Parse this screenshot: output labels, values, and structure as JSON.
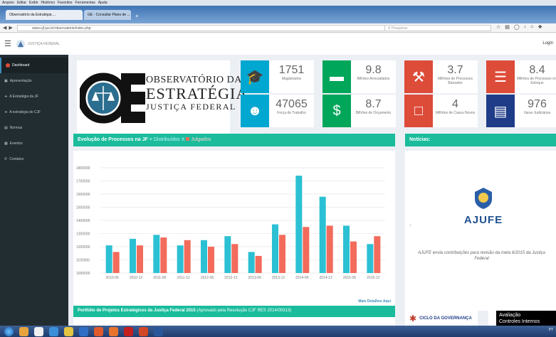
{
  "browser": {
    "menu": [
      "Arquivo",
      "Editar",
      "Exibir",
      "Histórico",
      "Favoritos",
      "Ferramentas",
      "Ajuda"
    ],
    "tabs": [
      {
        "label": "Observatório da Estratégia ..."
      },
      {
        "label": "GE - Consultar Plano de ..."
      }
    ],
    "new_tab": "+",
    "url": "www.cjf.jus.br/observatorio/index.php",
    "search_placeholder": "Pesquisar"
  },
  "header": {
    "brand": "JUSTIÇA FEDERAL",
    "login": "Login"
  },
  "sidebar": {
    "items": [
      {
        "label": "Dashboard",
        "icon": "dashboard-icon"
      },
      {
        "label": "Apresentação",
        "icon": "book-icon"
      },
      {
        "label": "A Estratégia da JF",
        "icon": "arrow-right-icon"
      },
      {
        "label": "A estratégia do CJF",
        "icon": "arrow-right-icon"
      },
      {
        "label": "Normas",
        "icon": "document-icon"
      },
      {
        "label": "Eventos",
        "icon": "calendar-icon"
      },
      {
        "label": "Contatos",
        "icon": "phone-icon"
      }
    ]
  },
  "logo": {
    "letters": "OE",
    "line1": "OBSERVATÓRIO DA",
    "line2": "ESTRATÉGIA",
    "line3": "JUSTIÇA FEDERAL"
  },
  "stats": [
    {
      "value": "1751",
      "label": "Magistrados",
      "color": "#00a7d0",
      "icon": "graduation-cap-icon"
    },
    {
      "value": "9.8",
      "label": "Bilhões Arrecadados",
      "color": "#00a65a",
      "icon": "credit-card-icon"
    },
    {
      "value": "3.7",
      "label": "Milhões de Processos Baixados",
      "color": "#dd4b39",
      "icon": "gavel-icon"
    },
    {
      "value": "8.4",
      "label": "Milhões de Processos em Estoque",
      "color": "#dd4b39",
      "icon": "list-icon"
    },
    {
      "value": "47065",
      "label": "Força de Trabalho",
      "color": "#00a7d0",
      "icon": "users-icon"
    },
    {
      "value": "8.7",
      "label": "Bilhões de Orçamento",
      "color": "#00a65a",
      "icon": "dollar-icon"
    },
    {
      "value": "4",
      "label": "Milhões de Casos Novos",
      "color": "#dd4b39",
      "icon": "file-icon"
    },
    {
      "value": "976",
      "label": "Varas Judiciárias",
      "color": "#1f3c88",
      "icon": "institution-icon"
    }
  ],
  "chart_panel": {
    "title": "Evolução de Processos na JF",
    "legend_distribuidos": "Distribuídos X",
    "legend_julgados": "Julgados",
    "more_link": "Mais Detalhes Aqui",
    "color": "#1abc9c"
  },
  "chart_data": {
    "type": "bar",
    "categories": [
      "2010-06",
      "2010-12",
      "2011-06",
      "2011-12",
      "2012-06",
      "2012-12",
      "2013-06",
      "2013-12",
      "2014-06",
      "2014-12",
      "2015-06",
      "2015-12"
    ],
    "series": [
      {
        "name": "Distribuídos",
        "color": "#2bc0d3",
        "values": [
          1210000,
          1260000,
          1290000,
          1210000,
          1250000,
          1280000,
          1160000,
          1370000,
          1740000,
          1580000,
          1360000,
          1220000
        ]
      },
      {
        "name": "Julgados",
        "color": "#f26b5b",
        "values": [
          1160000,
          1210000,
          1270000,
          1250000,
          1200000,
          1220000,
          1130000,
          1290000,
          1350000,
          1360000,
          1240000,
          1280000
        ]
      }
    ],
    "y_ticks": [
      "1000000",
      "1100000",
      "1200000",
      "1300000",
      "1400000",
      "1500000",
      "1600000",
      "1700000",
      "1800000"
    ],
    "ylim": [
      1000000,
      1800000
    ],
    "grid": true
  },
  "news_panel": {
    "title": "Notícias:",
    "logo_text": "AJUFE",
    "caption": "AJUFE envia contribuições para revisão da meta 6/2015 da Justiça Federal"
  },
  "bottom_panel": {
    "title": "Portfólio de Projetos Estratégicos da Justiça Federal 2015",
    "subtitle": "(Aprovado pela Resolução CJF RES 2014/00313)"
  },
  "bottom_right": {
    "ciclo": "CICLO DA GOVERNANÇA"
  },
  "popup": {
    "line1": "Avaliação",
    "line2": "Controles Internos"
  },
  "taskbar": {
    "tray": "PT"
  }
}
